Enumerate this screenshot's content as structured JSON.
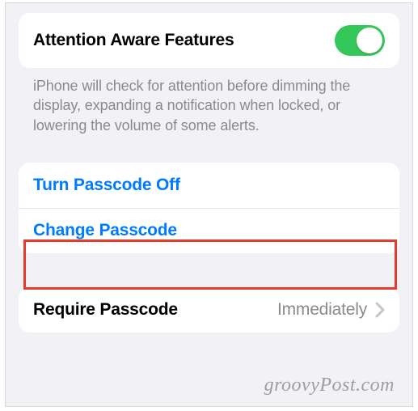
{
  "attention": {
    "title": "Attention Aware Features",
    "toggle_on": true,
    "footer": "iPhone will check for attention before dimming the display, expanding a notification when locked, or lowering the volume of some alerts."
  },
  "passcode_actions": {
    "turn_off": "Turn Passcode Off",
    "change": "Change Passcode"
  },
  "require": {
    "label": "Require Passcode",
    "value": "Immediately"
  },
  "watermark": "groovyPost.com"
}
